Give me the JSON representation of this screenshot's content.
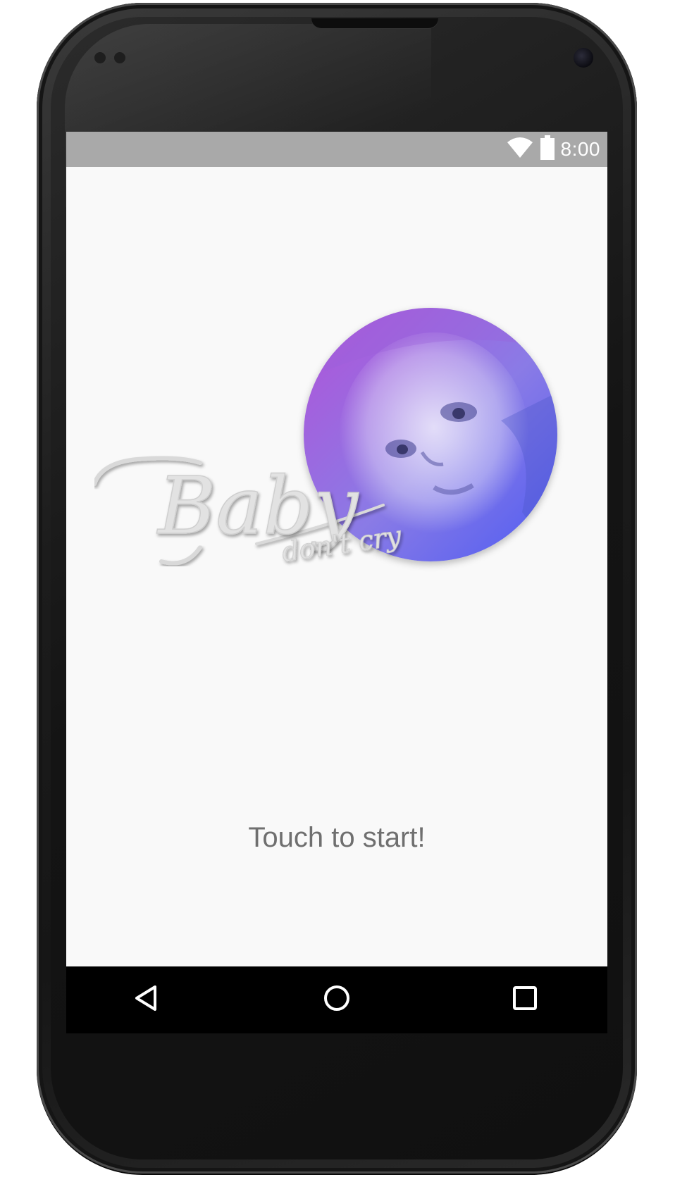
{
  "status_bar": {
    "time": "8:00",
    "icons": [
      "wifi-icon",
      "battery-icon"
    ]
  },
  "app": {
    "logo_main_text": "Baby",
    "logo_sub_text": "don't cry",
    "prompt": "Touch to start!"
  },
  "nav_bar": {
    "buttons": [
      "back-icon",
      "home-icon",
      "recents-icon"
    ]
  },
  "colors": {
    "screen_bg": "#f9f9f9",
    "status_bar_bg": "#a9a9a9",
    "photo_gradient_start": "#b152d8",
    "photo_gradient_end": "#5660f0",
    "prompt_text": "#6f6f6f",
    "nav_bar_bg": "#000000"
  }
}
